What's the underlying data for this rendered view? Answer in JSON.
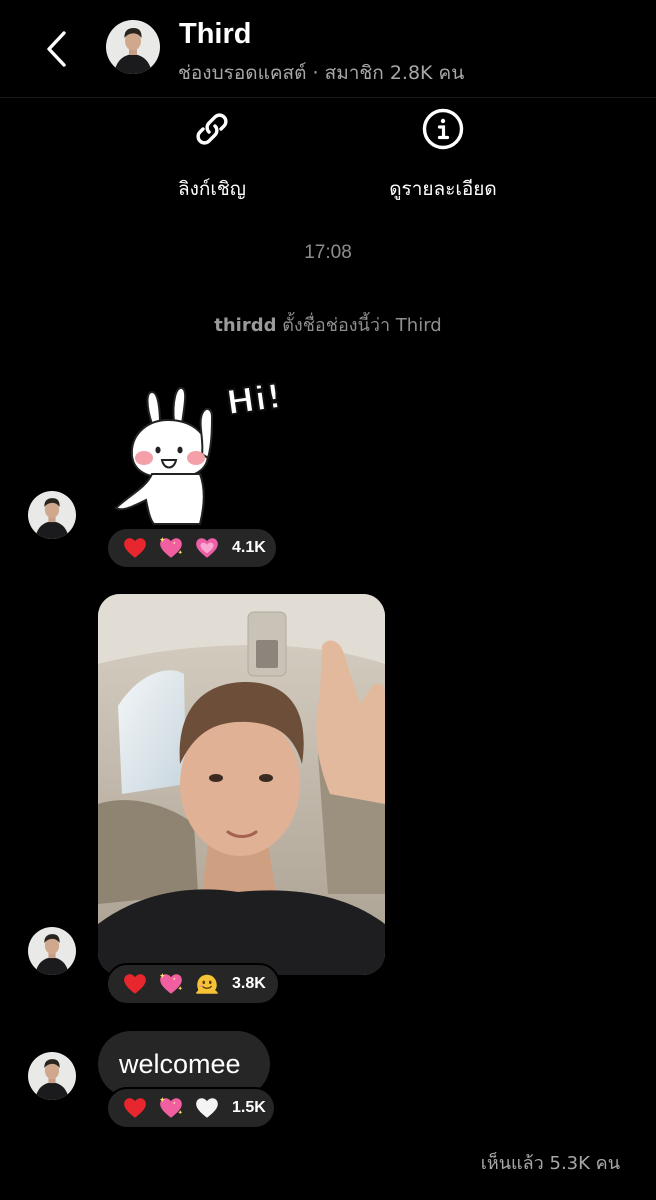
{
  "header": {
    "back_icon": "chevron-left-icon",
    "title": "Third",
    "subtitle": "ช่องบรอดแคสต์ · สมาชิก 2.8K คน"
  },
  "actions": [
    {
      "icon": "link-icon",
      "label": "ลิงก์เชิญ"
    },
    {
      "icon": "info-icon",
      "label": "ดูรายละเอียด"
    }
  ],
  "thread": {
    "timestamp": "17:08",
    "system_message": {
      "user": "thirdd",
      "text": " ตั้งชื่อช่องนี้ว่า Third"
    },
    "messages": [
      {
        "type": "sticker",
        "sticker_text": "Hi!",
        "reactions": {
          "emojis": [
            "heart",
            "sparkling-heart",
            "growing-heart"
          ],
          "count": "4.1K"
        }
      },
      {
        "type": "photo",
        "reactions": {
          "emojis": [
            "heart",
            "sparkling-heart",
            "melting-face"
          ],
          "count": "3.8K"
        }
      },
      {
        "type": "text",
        "text": "welcomee",
        "reactions": {
          "emojis": [
            "heart",
            "sparkling-heart",
            "white-heart"
          ],
          "count": "1.5K"
        }
      }
    ],
    "seen_status": "เห็นแล้ว 5.3K คน"
  },
  "colors": {
    "background": "#000000",
    "bubble": "#262626",
    "muted_text": "#8e8e8e",
    "heart": "#e8262e",
    "pink_heart": "#f25fa0"
  }
}
